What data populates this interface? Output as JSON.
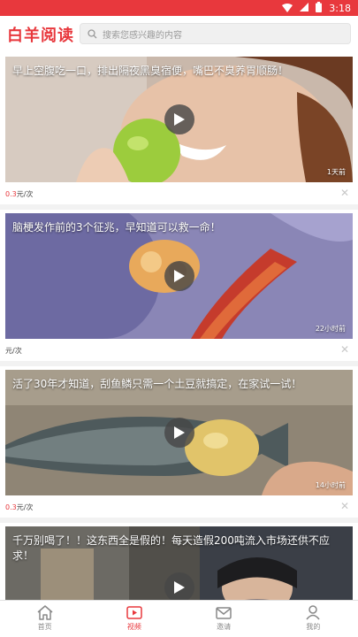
{
  "status_bar": {
    "time": "3:18"
  },
  "header": {
    "logo": "白羊阅读",
    "search_placeholder": "搜索您感兴趣的内容"
  },
  "feed": [
    {
      "title": "早上空腹吃一口，排出隔夜黑臭宿便，嘴巴不臭养胃顺肠！",
      "time": "1天前",
      "price_amount": "0.3",
      "price_unit": "元/次"
    },
    {
      "title": "脑梗发作前的3个征兆，早知道可以救一命！",
      "time": "22小时前",
      "price_amount": "",
      "price_unit": "元/次"
    },
    {
      "title": "活了30年才知道，刮鱼鳞只需一个土豆就搞定，在家试一试！",
      "time": "14小时前",
      "price_amount": "0.3",
      "price_unit": "元/次"
    },
    {
      "title": "千万别喝了！！这东西全是假的！每天造假200吨流入市场还供不应求！",
      "time": "",
      "price_amount": "",
      "price_unit": ""
    }
  ],
  "tabs": [
    {
      "label": "首页",
      "icon": "home-icon",
      "active": false
    },
    {
      "label": "视频",
      "icon": "video-icon",
      "active": true
    },
    {
      "label": "邀请",
      "icon": "invite-icon",
      "active": false
    },
    {
      "label": "我的",
      "icon": "profile-icon",
      "active": false
    }
  ],
  "colors": {
    "accent": "#e8383d"
  }
}
